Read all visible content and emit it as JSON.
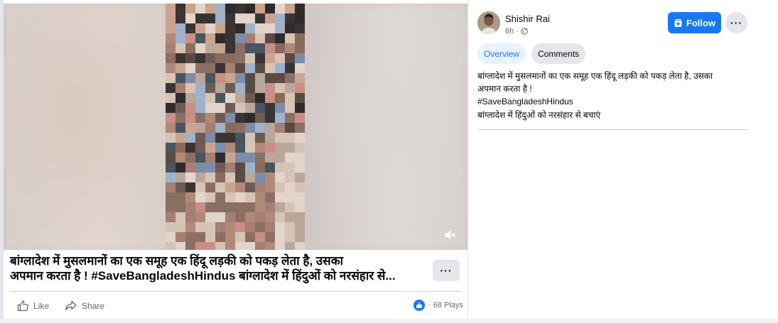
{
  "post": {
    "caption_line1": "बांग्लादेश में मुसलमानों का एक समूह एक हिंदू लड़की को पकड़ लेता है, उसका",
    "caption_line2": "अपमान करता है ! #SaveBangladeshHindus बांग्लादेश में हिंदुओं को नरसंहार से...",
    "more_label": "···",
    "like_label": "Like",
    "share_label": "Share",
    "plays_label": "· 68 Plays"
  },
  "panel": {
    "author": "Shishir Rai",
    "time": "6h ·",
    "follow_label": "Follow",
    "more_label": "···",
    "tabs": [
      {
        "label": "Overview",
        "active": true
      },
      {
        "label": "Comments",
        "active": false
      }
    ],
    "description": {
      "line1": "बांग्लादेश में मुसलमानों का एक समूह एक हिंदू लड़की को पकड़ लेता है, उसका",
      "line2": "अपमान करता है !",
      "hashtag": "#SaveBangladeshHindus",
      "line3": "बांग्लादेश में हिंदुओं को नरसंहार से बचाएं"
    }
  },
  "icons": {
    "mute": "speaker-muted-icon",
    "like": "thumbs-up-icon",
    "share": "share-arrow-icon",
    "globe": "globe-icon",
    "follow": "follow-page-icon"
  },
  "colors": {
    "accent": "#1877f2",
    "tab_active_bg": "#e7f3ff",
    "button_gray": "#e4e6eb",
    "text_primary": "#050505",
    "text_secondary": "#65676b"
  }
}
